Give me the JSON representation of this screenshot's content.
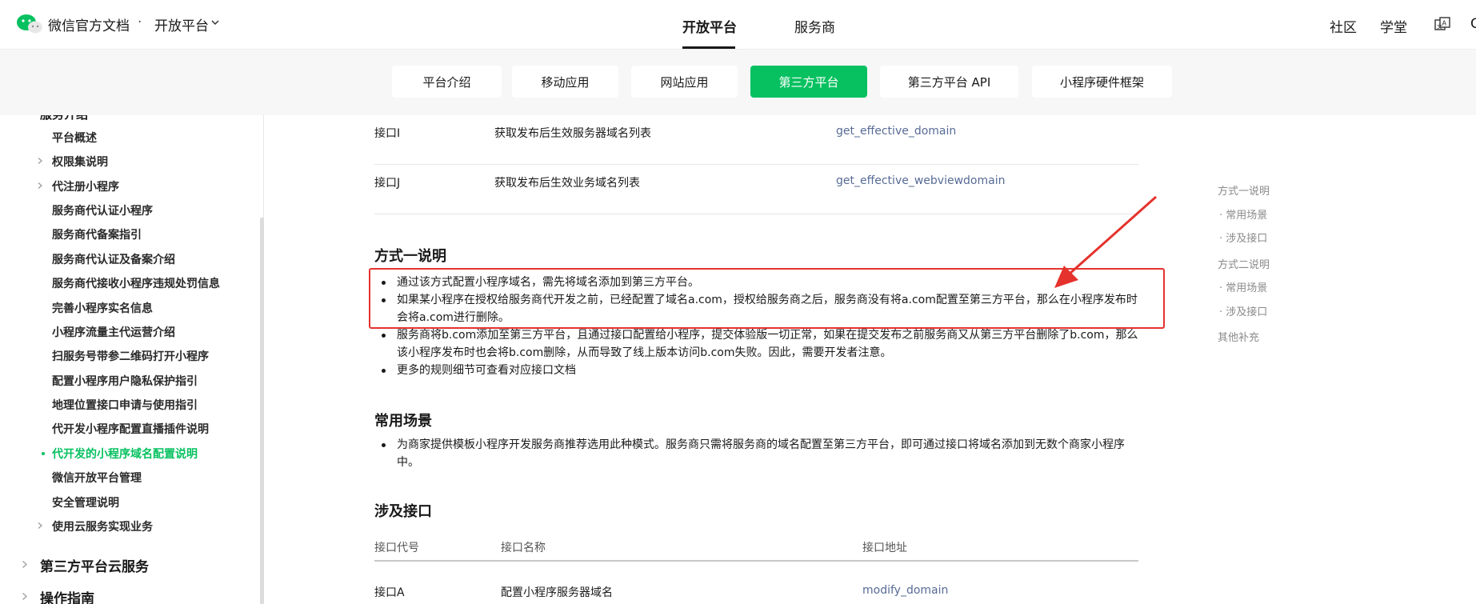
{
  "header": {
    "brand": "微信官方文档",
    "brand_dot": "·",
    "brand_sub": "开放平台",
    "nav": [
      {
        "label": "开放平台",
        "active": true
      },
      {
        "label": "服务商",
        "active": false
      }
    ],
    "right": {
      "community": "社区",
      "academy": "学堂",
      "cut_char": "C"
    }
  },
  "subtabs": [
    {
      "label": "平台介绍",
      "active": false
    },
    {
      "label": "移动应用",
      "active": false
    },
    {
      "label": "网站应用",
      "active": false
    },
    {
      "label": "第三方平台",
      "active": true
    },
    {
      "label": "第三方平台 API",
      "active": false
    },
    {
      "label": "小程序硬件框架",
      "active": false
    }
  ],
  "sidebar": {
    "cut_heading": "服务介绍",
    "items": [
      {
        "label": "平台概述",
        "arrow": false,
        "active": false
      },
      {
        "label": "权限集说明",
        "arrow": true,
        "active": false
      },
      {
        "label": "代注册小程序",
        "arrow": true,
        "active": false
      },
      {
        "label": "服务商代认证小程序",
        "arrow": false,
        "active": false
      },
      {
        "label": "服务商代备案指引",
        "arrow": false,
        "active": false
      },
      {
        "label": "服务商代认证及备案介绍",
        "arrow": false,
        "active": false
      },
      {
        "label": "服务商代接收小程序违规处罚信息",
        "arrow": false,
        "active": false
      },
      {
        "label": "完善小程序实名信息",
        "arrow": false,
        "active": false
      },
      {
        "label": "小程序流量主代运营介绍",
        "arrow": false,
        "active": false
      },
      {
        "label": "扫服务号带参二维码打开小程序",
        "arrow": false,
        "active": false
      },
      {
        "label": "配置小程序用户隐私保护指引",
        "arrow": false,
        "active": false
      },
      {
        "label": "地理位置接口申请与使用指引",
        "arrow": false,
        "active": false
      },
      {
        "label": "代开发小程序配置直播插件说明",
        "arrow": false,
        "active": false
      },
      {
        "label": "代开发的小程序域名配置说明",
        "arrow": false,
        "active": true
      },
      {
        "label": "微信开放平台管理",
        "arrow": false,
        "active": false
      },
      {
        "label": "安全管理说明",
        "arrow": false,
        "active": false
      },
      {
        "label": "使用云服务实现业务",
        "arrow": true,
        "active": false
      }
    ],
    "sections": [
      "第三方平台云服务",
      "操作指南"
    ]
  },
  "main": {
    "top_rows": [
      {
        "code": "接口I",
        "name": "获取发布后生效服务器域名列表",
        "link": "get_effective_domain"
      },
      {
        "code": "接口J",
        "name": "获取发布后生效业务域名列表",
        "link": "get_effective_webviewdomain"
      }
    ],
    "method1_title": "方式一说明",
    "method1_bullets": [
      "通过该方式配置小程序域名，需先将域名添加到第三方平台。",
      "如果某小程序在授权给服务商代开发之前，已经配置了域名a.com，授权给服务商之后，服务商没有将a.com配置至第三方平台，那么在小程序发布时会将a.com进行删除。",
      "服务商将b.com添加至第三方平台，且通过接口配置给小程序，提交体验版一切正常，如果在提交发布之前服务商又从第三方平台删除了b.com，那么该小程序发布时也会将b.com删除，从而导致了线上版本访问b.com失败。因此，需要开发者注意。",
      "更多的规则细节可查看对应接口文档"
    ],
    "scenario_title": "常用场景",
    "scenario_bullets": [
      "为商家提供模板小程序开发服务商推荐选用此种模式。服务商只需将服务商的域名配置至第三方平台，即可通过接口将域名添加到无数个商家小程序中。"
    ],
    "api_title": "涉及接口",
    "api_headers": {
      "code": "接口代号",
      "name": "接口名称",
      "link": "接口地址"
    },
    "api_rows": [
      {
        "code": "接口A",
        "name": "配置小程序服务器域名",
        "link": "modify_domain"
      }
    ]
  },
  "toc": [
    {
      "label": "方式一说明",
      "sub": false
    },
    {
      "label": "· 常用场景",
      "sub": true
    },
    {
      "label": "· 涉及接口",
      "sub": true
    },
    {
      "label": "方式二说明",
      "sub": false
    },
    {
      "label": "· 常用场景",
      "sub": true
    },
    {
      "label": "· 涉及接口",
      "sub": true
    },
    {
      "label": "其他补充",
      "sub": false
    }
  ],
  "colors": {
    "accent": "#07c160",
    "link": "#576b95",
    "annotation": "#e5322d"
  },
  "icons": {
    "logo": "wechat-logo-icon",
    "chevron": "chevron-down-icon",
    "translate": "translate-icon",
    "arrow": "chevron-right-icon",
    "annotation_arrow": "red-arrow-annotation"
  }
}
